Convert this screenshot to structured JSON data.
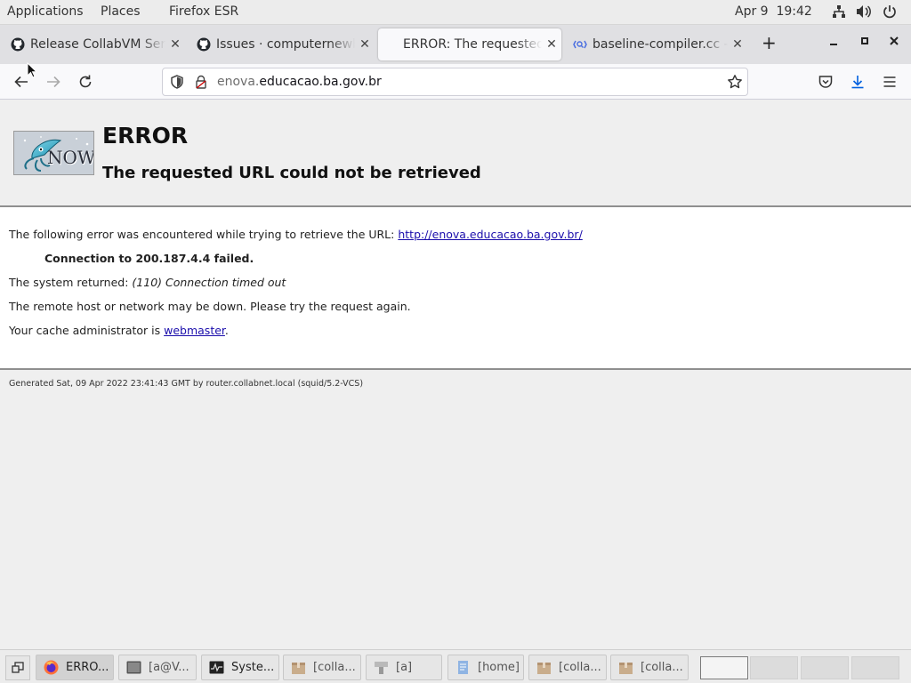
{
  "topbar": {
    "applications": "Applications",
    "places": "Places",
    "app_name": "Firefox ESR",
    "datetime": "Apr 9  19:42",
    "tray_icons": [
      "network-icon",
      "volume-icon",
      "power-icon"
    ]
  },
  "tabs": [
    {
      "label": "Release CollabVM Server",
      "icon": "github-icon",
      "active": false
    },
    {
      "label": "Issues · computernewb/collabvm",
      "icon": "github-icon",
      "active": false
    },
    {
      "label": "ERROR: The requested URL could not be retrieved",
      "icon": "none",
      "active": true
    },
    {
      "label": "baseline-compiler.cc - Search",
      "icon": "search-icon",
      "active": false
    }
  ],
  "window_controls": [
    "new-tab-icon",
    "minimize-icon",
    "maximize-icon",
    "close-icon"
  ],
  "navbar": {
    "url_prefix": "enova.",
    "url_domain": "educacao.ba.gov.br"
  },
  "page": {
    "title": "ERROR",
    "subtitle": "The requested URL could not be retrieved",
    "logo_text": "NOW",
    "intro": "The following error was encountered while trying to retrieve the URL: ",
    "intro_link": "http://enova.educacao.ba.gov.br/",
    "connection_failed": "Connection to 200.187.4.4 failed.",
    "system_returned_prefix": "The system returned: ",
    "system_returned_value": "(110) Connection timed out",
    "remote_host": "The remote host or network may be down. Please try the request again.",
    "cache_admin_prefix": "Your cache administrator is ",
    "cache_admin_link": "webmaster",
    "cache_admin_suffix": ".",
    "footer": "Generated Sat, 09 Apr 2022 23:41:43 GMT by router.collabnet.local (squid/5.2-VCS)"
  },
  "taskbar": {
    "items": [
      {
        "label": "ERRO...",
        "icon": "firefox-icon",
        "active": true
      },
      {
        "label": "[a@V...",
        "icon": "terminal-icon",
        "active": false
      },
      {
        "label": "Syste...",
        "icon": "system-monitor-icon",
        "active": false
      },
      {
        "label": "[colla...",
        "icon": "package-icon",
        "active": false
      },
      {
        "label": "[a]",
        "icon": "drive-icon",
        "active": false
      },
      {
        "label": "[home]",
        "icon": "document-icon",
        "active": false
      },
      {
        "label": "[colla...",
        "icon": "package-icon",
        "active": false
      },
      {
        "label": "[colla...",
        "icon": "package-icon",
        "active": false
      }
    ],
    "workspaces": 4,
    "active_workspace": 1
  },
  "colors": {
    "link": "#1a0dab",
    "download_accent": "#0060df"
  }
}
